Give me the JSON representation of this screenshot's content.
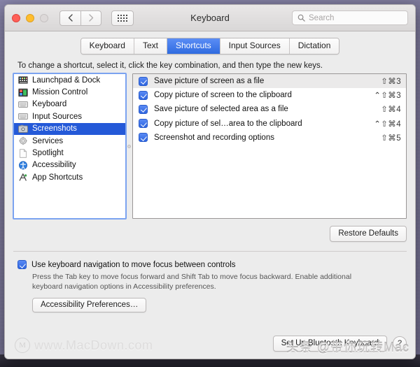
{
  "window": {
    "title": "Keyboard",
    "traffic": {
      "close": "close-button",
      "minimize": "minimize-button",
      "maximize": "maximize-button"
    },
    "nav": {
      "back": "‹",
      "forward": "›"
    },
    "grid_button_label": "show-all-preferences"
  },
  "search": {
    "placeholder": "Search",
    "value": ""
  },
  "tabs": [
    {
      "label": "Keyboard",
      "active": false
    },
    {
      "label": "Text",
      "active": false
    },
    {
      "label": "Shortcuts",
      "active": true
    },
    {
      "label": "Input Sources",
      "active": false
    },
    {
      "label": "Dictation",
      "active": false
    }
  ],
  "instruction": "To change a shortcut, select it, click the key combination, and then type the new keys.",
  "sidebar": {
    "items": [
      {
        "label": "Launchpad & Dock",
        "icon": "launchpad-dock-icon",
        "selected": false
      },
      {
        "label": "Mission Control",
        "icon": "mission-control-icon",
        "selected": false
      },
      {
        "label": "Keyboard",
        "icon": "keyboard-icon",
        "selected": false
      },
      {
        "label": "Input Sources",
        "icon": "input-sources-icon",
        "selected": false
      },
      {
        "label": "Screenshots",
        "icon": "screenshots-icon",
        "selected": true
      },
      {
        "label": "Services",
        "icon": "services-gear-icon",
        "selected": false
      },
      {
        "label": "Spotlight",
        "icon": "spotlight-page-icon",
        "selected": false
      },
      {
        "label": "Accessibility",
        "icon": "accessibility-icon",
        "selected": false
      },
      {
        "label": "App Shortcuts",
        "icon": "app-shortcuts-icon",
        "selected": false
      }
    ]
  },
  "shortcuts": [
    {
      "label": "Save picture of screen as a file",
      "keys": "⇧⌘3",
      "checked": true,
      "highlighted": true
    },
    {
      "label": "Copy picture of screen to the clipboard",
      "keys": "⌃⇧⌘3",
      "checked": true,
      "highlighted": false
    },
    {
      "label": "Save picture of selected area as a file",
      "keys": "⇧⌘4",
      "checked": true,
      "highlighted": false
    },
    {
      "label": "Copy picture of sel…area to the clipboard",
      "keys": "⌃⇧⌘4",
      "checked": true,
      "highlighted": false
    },
    {
      "label": "Screenshot and recording options",
      "keys": "⇧⌘5",
      "checked": true,
      "highlighted": false
    }
  ],
  "buttons": {
    "restore_defaults": "Restore Defaults",
    "accessibility_preferences": "Accessibility Preferences…",
    "set_up_bluetooth_keyboard": "Set Up Bluetooth Keyboard",
    "help": "?"
  },
  "keyboard_navigation": {
    "checked": true,
    "label": "Use keyboard navigation to move focus between controls",
    "description": "Press the Tab key to move focus forward and Shift Tab to move focus backward. Enable additional keyboard navigation options in Accessibility preferences."
  },
  "watermarks": {
    "left": "www.MacDown.com",
    "left_logo": "M",
    "right": "头条 @带你玩转Mac"
  },
  "colors": {
    "accent": "#2f6be0",
    "selection": "#2459d8",
    "window_bg": "#ececec",
    "desktop": "#7b7799"
  }
}
